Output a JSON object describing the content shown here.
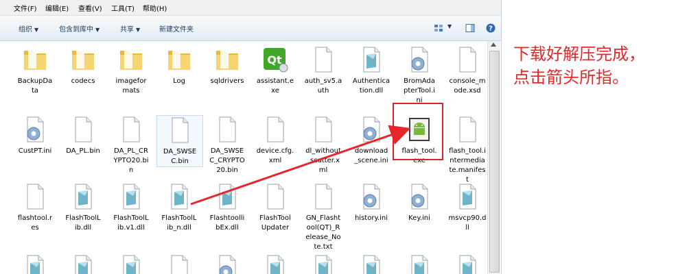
{
  "menubar": [
    "文件(F)",
    "编辑(E)",
    "查看(V)",
    "工具(T)",
    "帮助(H)"
  ],
  "toolbar": {
    "organize": "组织",
    "include_library": "包含到库中",
    "share": "共享",
    "new_folder": "新建文件夹"
  },
  "files": [
    {
      "name": "BackupData",
      "label": "BackupDa\nta",
      "type": "folder"
    },
    {
      "name": "codecs",
      "label": "codecs",
      "type": "folder"
    },
    {
      "name": "imageformats",
      "label": "imagefor\nmats",
      "type": "folder"
    },
    {
      "name": "Log",
      "label": "Log",
      "type": "folder"
    },
    {
      "name": "sqldrivers",
      "label": "sqldrivers",
      "type": "folder"
    },
    {
      "name": "assistant.exe",
      "label": "assistant.e\nxe",
      "type": "qt"
    },
    {
      "name": "auth_sv5.auth",
      "label": "auth_sv5.a\nuth",
      "type": "doc"
    },
    {
      "name": "Authentication.dll",
      "label": "Authentica\ntion.dll",
      "type": "dll"
    },
    {
      "name": "BromAdapterTool.ini",
      "label": "BromAda\npterTool.i\nni",
      "type": "ini"
    },
    {
      "name": "console_mode.xsd",
      "label": "console_m\node.xsd",
      "type": "doc"
    },
    {
      "name": "CustPT.ini",
      "label": "CustPT.ini",
      "type": "ini"
    },
    {
      "name": "DA_PL.bin",
      "label": "DA_PL.bin",
      "type": "doc"
    },
    {
      "name": "DA_PL_CRYPTO20.bin",
      "label": "DA_PL_CR\nYPTO20.bi\nn",
      "type": "doc"
    },
    {
      "name": "DA_SWSEC.bin",
      "label": "DA_SWSE\nC.bin",
      "type": "doc"
    },
    {
      "name": "DA_SWSEC_CRYPTO20.bin",
      "label": "DA_SWSE\nC_CRYPTO\n20.bin",
      "type": "doc"
    },
    {
      "name": "device.cfg.xml",
      "label": "device.cfg.\nxml",
      "type": "doc"
    },
    {
      "name": "dl_without_scatter.xml",
      "label": "dl_without\n_scatter.x\nml",
      "type": "doc"
    },
    {
      "name": "download_scene.ini",
      "label": "download\n_scene.ini",
      "type": "ini"
    },
    {
      "name": "flash_tool.exe",
      "label": "flash_tool.\nexe",
      "type": "android"
    },
    {
      "name": "flash_tool.intermediate.manifest",
      "label": "flash_tool.i\nntermedia\nte.manifes\nt",
      "type": "doc"
    },
    {
      "name": "flashtool.res",
      "label": "flashtool.r\nes",
      "type": "doc"
    },
    {
      "name": "FlashToolLib.dll",
      "label": "FlashToolL\nib.dll",
      "type": "dll"
    },
    {
      "name": "FlashToolLib.v1.dll",
      "label": "FlashToolL\nib.v1.dll",
      "type": "dll"
    },
    {
      "name": "FlashToolLib_n.dll",
      "label": "FlashToolL\nib_n.dll",
      "type": "dll"
    },
    {
      "name": "FlashtoolLibEx.dll",
      "label": "Flashtoolli\nbEx.dll",
      "type": "dll"
    },
    {
      "name": "FlashToolUpdater",
      "label": "FlashTool\nUpdater",
      "type": "doc"
    },
    {
      "name": "GN_Flashtool(QT)_Release_Note.txt",
      "label": "GN_Flasht\nool(QT)_R\nelease_No\nte.txt",
      "type": "doc"
    },
    {
      "name": "history.ini",
      "label": "history.ini",
      "type": "ini"
    },
    {
      "name": "Key.ini",
      "label": "Key.ini",
      "type": "ini"
    },
    {
      "name": "msvcp90.dll",
      "label": "msvcp90.d\nll",
      "type": "dll"
    },
    {
      "name": "row4-1",
      "label": "",
      "type": "dll"
    },
    {
      "name": "row4-2",
      "label": "",
      "type": "dll"
    },
    {
      "name": "row4-3",
      "label": "",
      "type": "dll"
    },
    {
      "name": "row4-4",
      "label": "",
      "type": "doc"
    },
    {
      "name": "row4-5",
      "label": "",
      "type": "ini"
    },
    {
      "name": "row4-6",
      "label": "",
      "type": "dll"
    },
    {
      "name": "row4-7",
      "label": "",
      "type": "dll"
    },
    {
      "name": "row4-8",
      "label": "",
      "type": "dll"
    },
    {
      "name": "row4-9",
      "label": "",
      "type": "dll"
    },
    {
      "name": "row4-10",
      "label": "",
      "type": "dll"
    }
  ],
  "annotation": {
    "line1": "下载好解压完成，",
    "line2": "点击箭头所指。",
    "color": "#e8262a"
  },
  "highlighted_file": "flash_tool.exe"
}
